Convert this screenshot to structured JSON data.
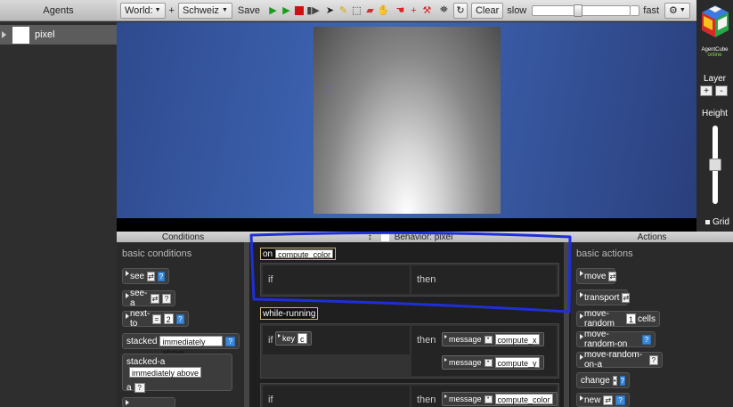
{
  "agents_panel": {
    "header": "Agents",
    "items": [
      {
        "label": "pixel"
      }
    ]
  },
  "toolbar": {
    "world_label": "World:",
    "plus": "+",
    "world_name": "Schweiz",
    "save": "Save",
    "clear": "Clear",
    "slow": "slow",
    "fast": "fast"
  },
  "right_column": {
    "brand": "AgentCube",
    "brand_sub": "online",
    "layer_label": "Layer",
    "layer_plus": "+",
    "layer_minus": "-",
    "height_label": "Height",
    "height_level_fraction": 0.5,
    "grid_label": "Grid"
  },
  "conditions": {
    "header": "Conditions",
    "section": "basic conditions",
    "items": [
      {
        "label": "see"
      },
      {
        "label": "see-a"
      },
      {
        "label": "next-to",
        "value": "2"
      },
      {
        "label": "stacked",
        "value": "immediately above"
      },
      {
        "label": "stacked-a",
        "value": "immediately above",
        "extra": "a"
      }
    ]
  },
  "behavior": {
    "header": "Behavior: pixel",
    "if_label": "if",
    "then_label": "then",
    "method_1": {
      "on": "on",
      "name": "compute_color"
    },
    "method_2": {
      "name": "while-running"
    },
    "rule_2_key": "key",
    "rule_2_key_value": "c",
    "rule_2_messages": [
      {
        "label": "message",
        "value": "compute_x"
      },
      {
        "label": "message",
        "value": "compute_y"
      }
    ],
    "rule_3_messages": [
      {
        "label": "message",
        "value": "compute_color"
      }
    ]
  },
  "actions": {
    "header": "Actions",
    "section": "basic actions",
    "items": [
      {
        "label": "move"
      },
      {
        "label": "transport"
      },
      {
        "label": "move-random",
        "value": "1",
        "suffix": "cells"
      },
      {
        "label": "move-random-on"
      },
      {
        "label": "move-random-on-a"
      },
      {
        "label": "change"
      },
      {
        "label": "new"
      }
    ]
  },
  "colors": {
    "annotation": "#1f2fd8",
    "world_blue": "#3f67b7",
    "play": "#1a9b1a",
    "stop": "#d01010"
  }
}
